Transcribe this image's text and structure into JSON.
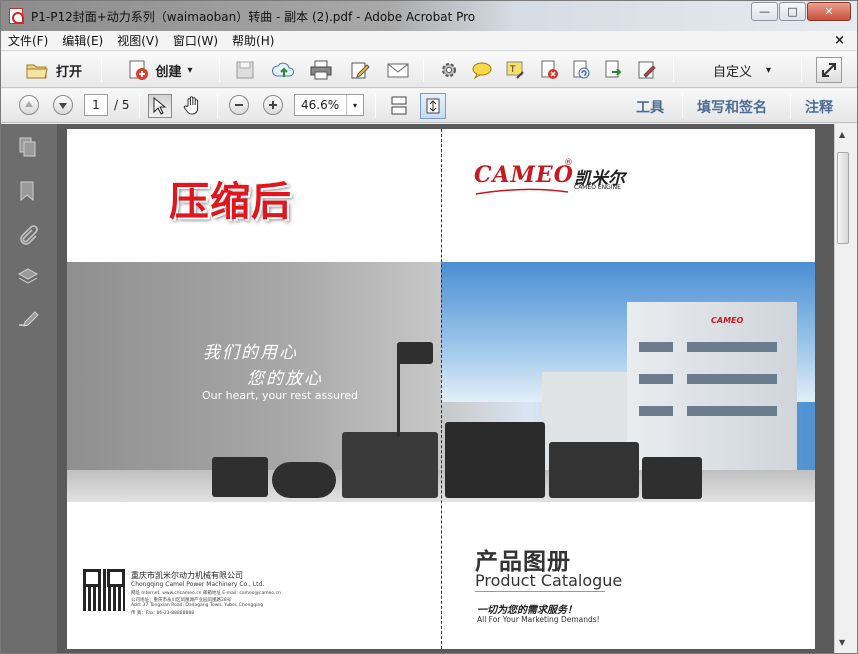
{
  "window": {
    "title": "P1-P12封面+动力系列（waimaoban）转曲 - 副本 (2).pdf - Adobe Acrobat Pro",
    "minimize": "—",
    "maximize": "□",
    "close": "✕"
  },
  "menu": {
    "items": [
      "文件(F)",
      "编辑(E)",
      "视图(V)",
      "窗口(W)",
      "帮助(H)"
    ],
    "close_glyph": "×"
  },
  "toolbar": {
    "open_label": "打开",
    "create_label": "创建",
    "customize_label": "自定义",
    "dropdown_glyph": "▾"
  },
  "navigation": {
    "current_page": "1",
    "total_pages": "/ 5",
    "zoom": "46.6%",
    "tools_link": "工具",
    "fill_sign_link": "填写和签名",
    "comment_link": "注释"
  },
  "document": {
    "stamp_text": "压缩后",
    "logo_en": "CAMEO",
    "logo_registered": "®",
    "logo_cn": "凯米尔",
    "logo_sub": "CAMEO ENGINE",
    "slogan_cn_line1": "我们的用心",
    "slogan_cn_line2": "您的放心",
    "slogan_en": "Our heart, your rest assured",
    "building_sign": "CAMEO",
    "company_cn": "重庆市凯米尔动力机械有限公司",
    "company_en": "Chongqing Camel Power Machinery Co., Ltd.",
    "company_line1": "网址 Internet: www.cncameo.cn    邮箱地址 E-mail: cameo@cameo.cn",
    "company_line2": "公司地址：重庆市永川区凤凰湖产业园凤凰路28号",
    "company_line3": "Add: 37 Tongxian Road, Dadagang Town, Yubei, Chongqing",
    "company_line4": "传 真：Fax: 86-23-88888888",
    "catalogue_cn": "产品图册",
    "catalogue_en": "Product Catalogue",
    "service_cn": "一切为您的需求服务！",
    "service_en": "All For Your Marketing Demands!"
  },
  "colors": {
    "accent_link": "#4a6e96",
    "stamp_red": "#e2141c",
    "brand_red": "#c8191f"
  },
  "icons": {
    "open": "folder-icon",
    "create": "create-pdf-icon",
    "save": "save-icon",
    "upload": "cloud-upload-icon",
    "print": "print-icon",
    "edit": "edit-icon",
    "email": "email-icon",
    "settings": "gear-icon",
    "comment": "comment-bubble-icon",
    "highlight": "highlight-text-icon",
    "delete": "delete-page-icon",
    "rotate": "rotate-icon",
    "export": "export-icon",
    "sign": "sign-icon",
    "expand": "expand-icon"
  }
}
